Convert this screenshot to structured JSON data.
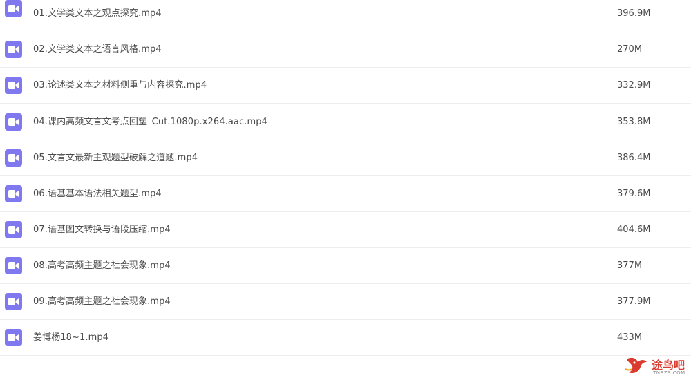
{
  "files": [
    {
      "name": "01.文学类文本之观点探究.mp4",
      "size": "396.9M",
      "icon": "video-file-icon"
    },
    {
      "name": "02.文学类文本之语言风格.mp4",
      "size": "270M",
      "icon": "video-file-icon"
    },
    {
      "name": "03.论述类文本之材料侧重与内容探究.mp4",
      "size": "332.9M",
      "icon": "video-file-icon"
    },
    {
      "name": "04.课内高频文言文考点回塑_Cut.1080p.x264.aac.mp4",
      "size": "353.8M",
      "icon": "video-file-icon"
    },
    {
      "name": "05.文言文最新主观题型破解之道题.mp4",
      "size": "386.4M",
      "icon": "video-file-icon"
    },
    {
      "name": "06.语基基本语法相关题型.mp4",
      "size": "379.6M",
      "icon": "video-file-icon"
    },
    {
      "name": "07.语基图文转换与语段压缩.mp4",
      "size": "404.6M",
      "icon": "video-file-icon"
    },
    {
      "name": "08.高考高频主题之社会现象.mp4",
      "size": "377M",
      "icon": "video-file-icon"
    },
    {
      "name": "09.高考高频主题之社会现象.mp4",
      "size": "377.9M",
      "icon": "video-file-icon"
    },
    {
      "name": "姜博杨18~1.mp4",
      "size": "433M",
      "icon": "video-file-icon"
    }
  ],
  "colors": {
    "icon_bg": "#7f78ee",
    "text": "#4a4a4a",
    "divider": "#eeeeee",
    "watermark": "#d93b2f"
  },
  "watermark": {
    "text": "途鸟吧",
    "sub": "TNBZS.COM"
  }
}
